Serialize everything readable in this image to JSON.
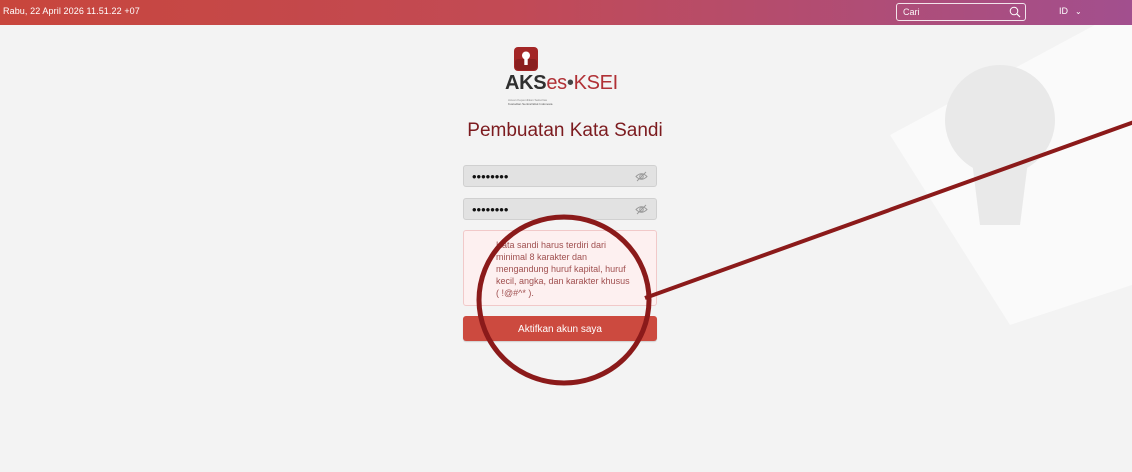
{
  "header": {
    "datetime": "Rabu, 22 April 2026 11.51.22 +07",
    "search_placeholder": "Cari",
    "language": "ID"
  },
  "logo": {
    "brand_main": "AKS",
    "brand_es": "es",
    "brand_dot": "•",
    "brand_ksei": "KSEI",
    "tagline_1": "Acuan Kepemilikan Sekuritas",
    "tagline_2": "Kustodian Sentral Efek Indonesia"
  },
  "form": {
    "title": "Pembuatan Kata Sandi",
    "password_value": "password",
    "confirm_value": "password",
    "error_message": "Kata sandi harus terdiri dari minimal 8 karakter dan mengandung huruf kapital, huruf kecil, angka, dan karakter khusus ( !@#^* ).",
    "submit_label": "Aktifkan akun saya"
  },
  "colors": {
    "header_start": "#c8463c",
    "header_end": "#a24f8e",
    "title": "#7c1b1f",
    "button": "#cc4a3f",
    "error_bg": "#fdf0f0",
    "annotation": "#8b1a1a"
  }
}
